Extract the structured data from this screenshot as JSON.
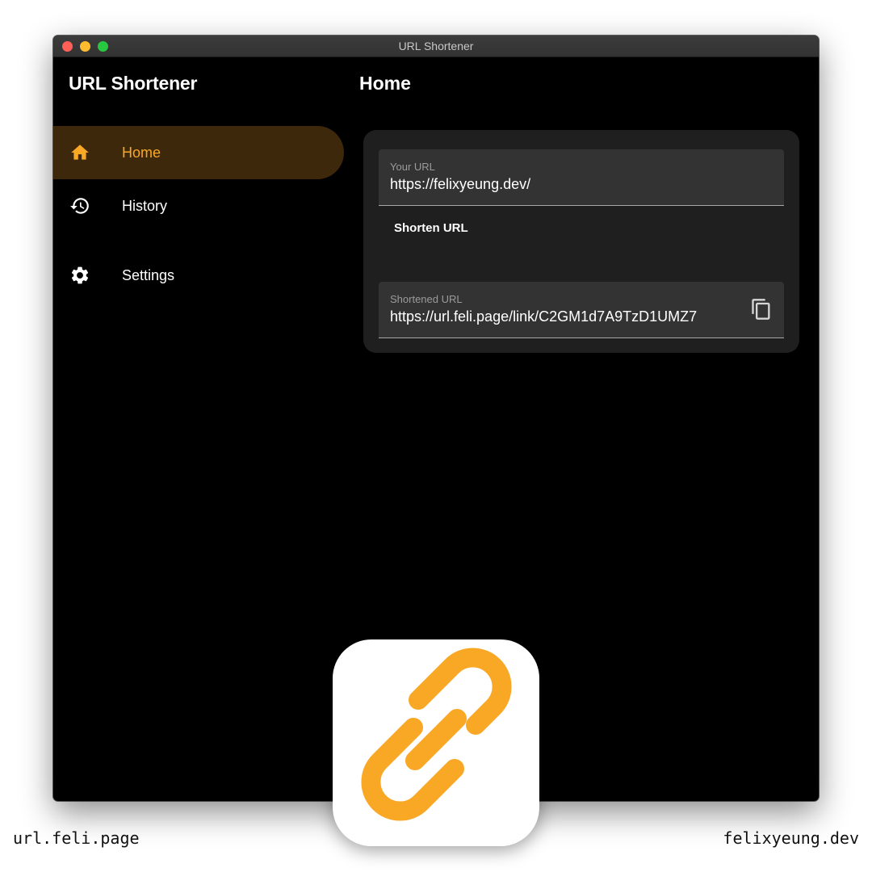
{
  "window": {
    "title": "URL Shortener"
  },
  "sidebar": {
    "app_title": "URL Shortener",
    "items": [
      {
        "label": "Home",
        "icon": "home-icon",
        "active": true
      },
      {
        "label": "History",
        "icon": "history-icon",
        "active": false
      },
      {
        "label": "Settings",
        "icon": "gear-icon",
        "active": false
      }
    ]
  },
  "main": {
    "page_title": "Home",
    "url_field": {
      "label": "Your URL",
      "value": "https://felixyeung.dev/"
    },
    "shorten_button": "Shorten URL",
    "shortened_field": {
      "label": "Shortened URL",
      "value": "https://url.feli.page/link/C2GM1d7A9TzD1UMZ7",
      "action_icon": "copy-icon"
    }
  },
  "footer": {
    "left": "url.feli.page",
    "right": "felixyeung.dev"
  },
  "colors": {
    "accent": "#f9a825",
    "active_nav_bg": "#3d280c",
    "window_bg": "#000000",
    "card_bg": "#1f1f1f",
    "field_bg": "#333333"
  },
  "app_icon": "link-icon"
}
